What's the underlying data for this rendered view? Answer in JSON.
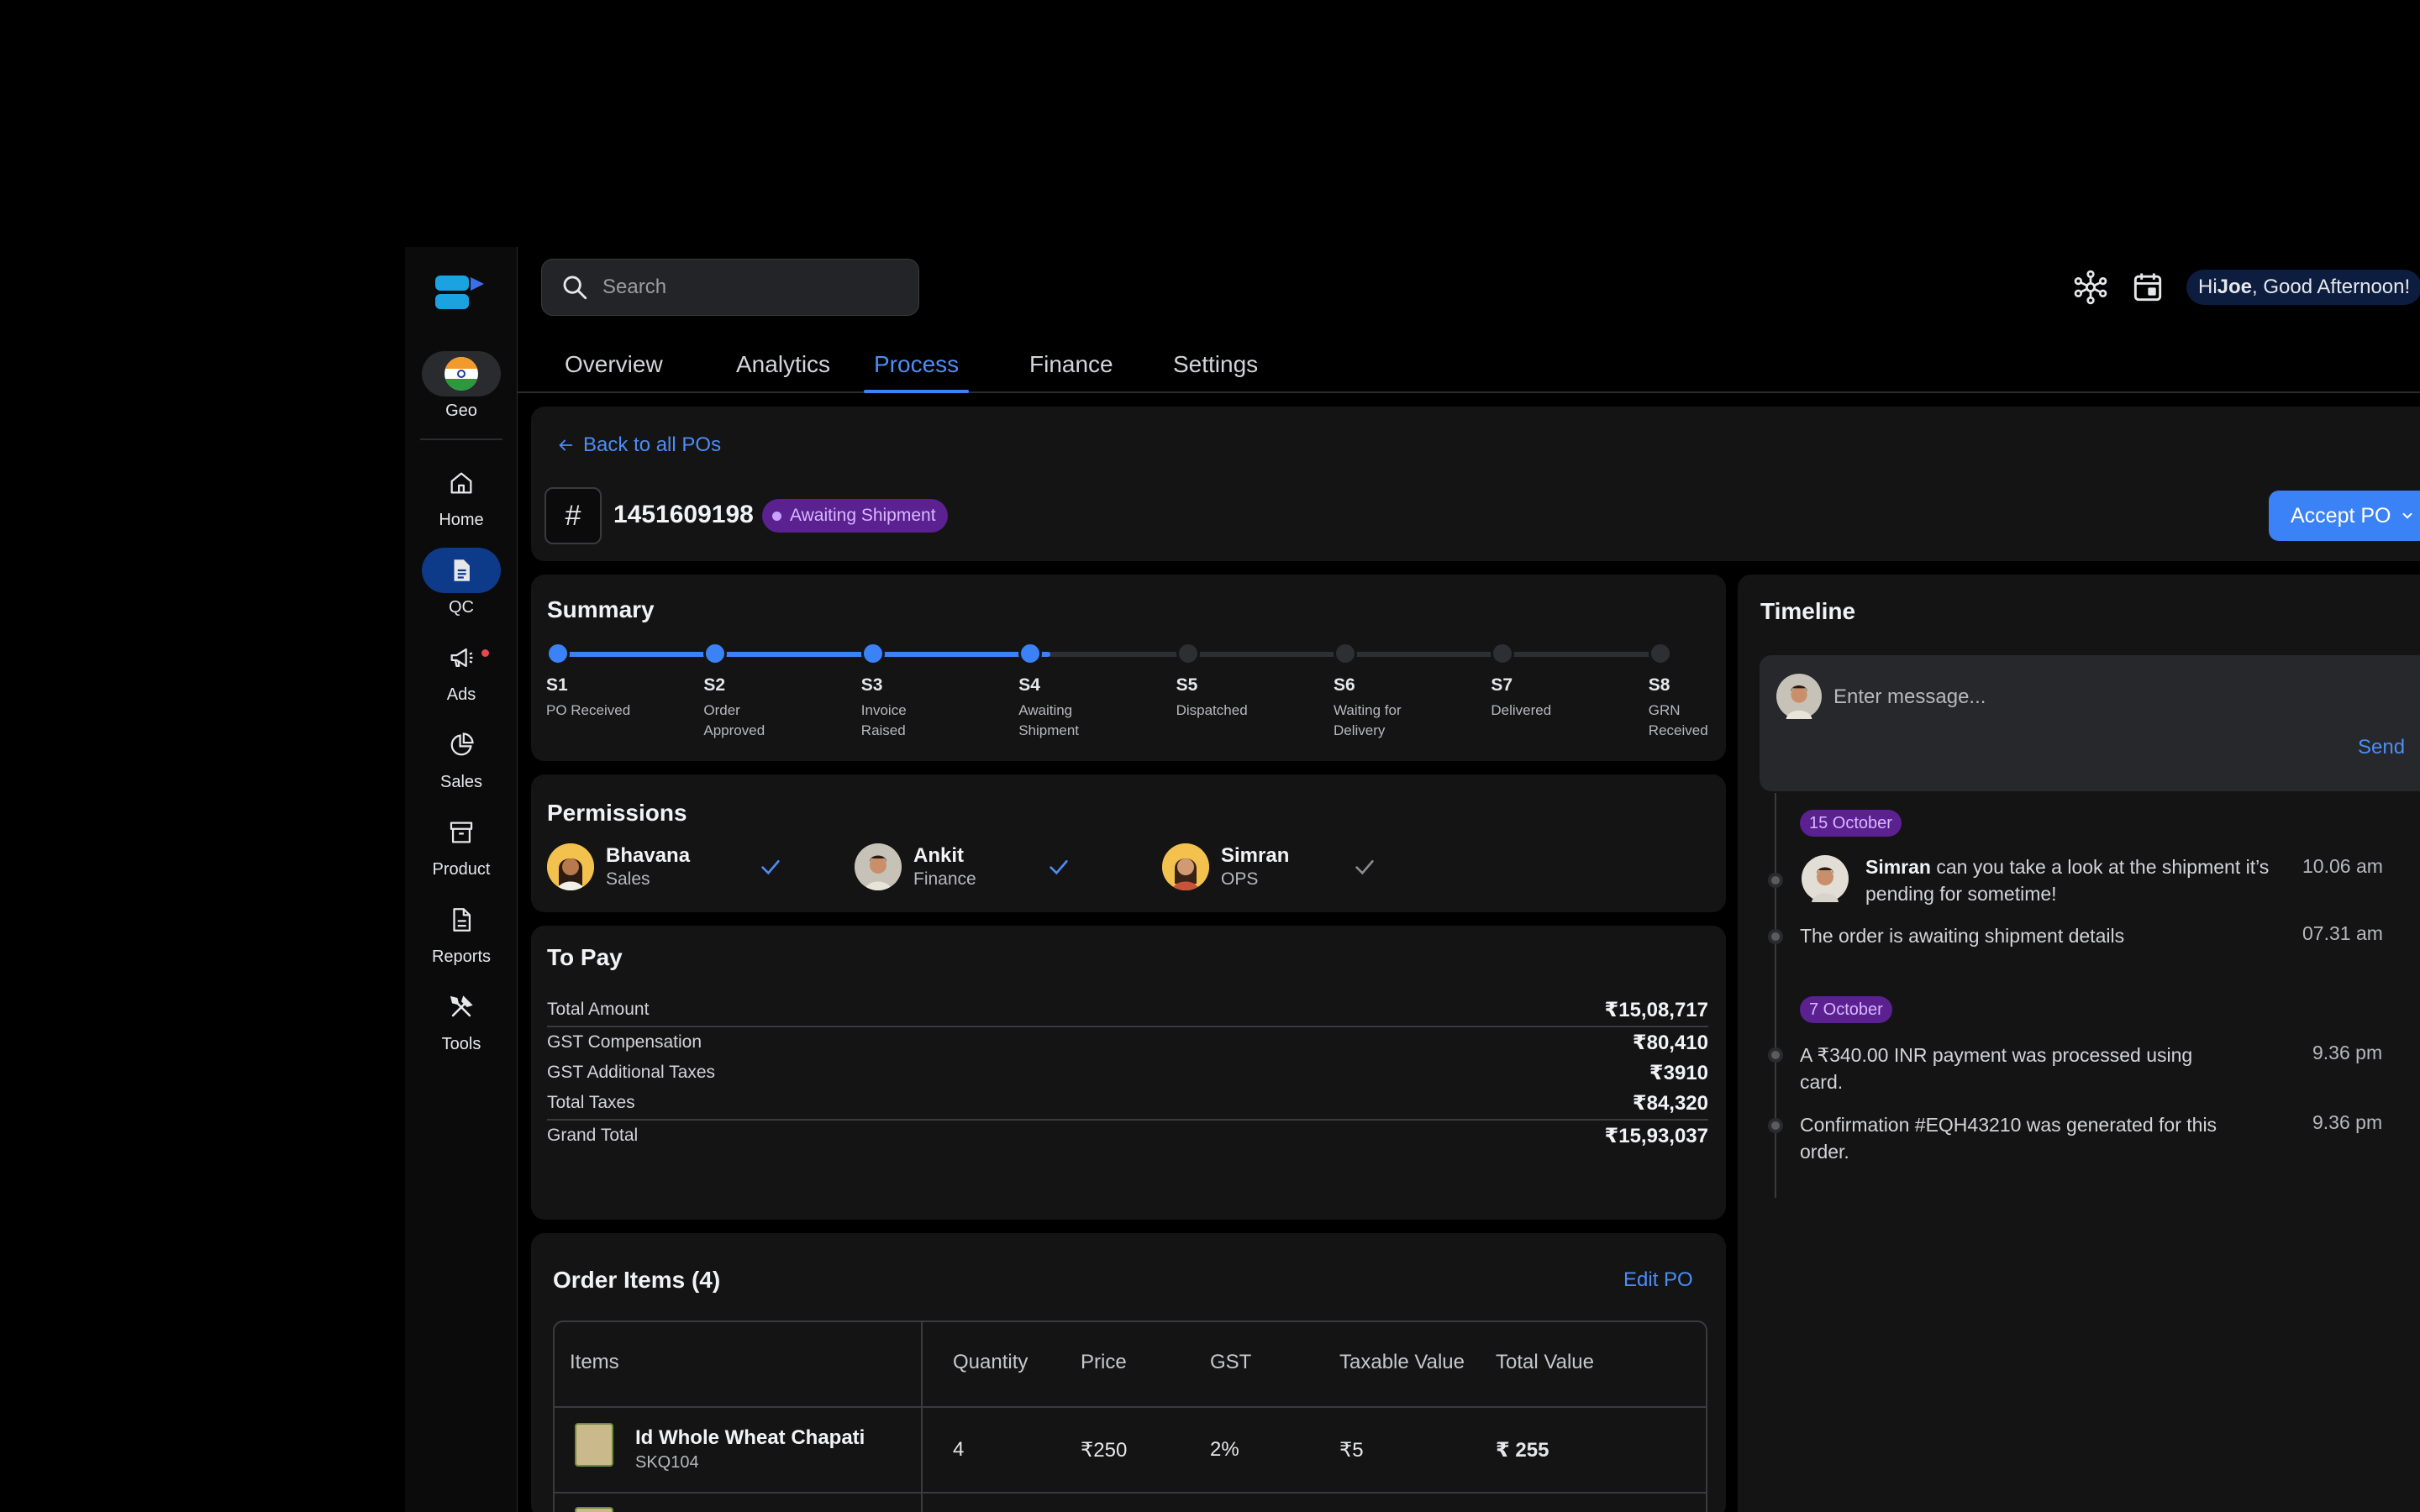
{
  "sidebar": {
    "geo_label": "Geo",
    "items": [
      {
        "label": "Home",
        "icon": "home-icon"
      },
      {
        "label": "QC",
        "icon": "document-icon",
        "active": true
      },
      {
        "label": "Ads",
        "icon": "megaphone-icon",
        "notification": true
      },
      {
        "label": "Sales",
        "icon": "pie-chart-icon"
      },
      {
        "label": "Product",
        "icon": "archive-icon"
      },
      {
        "label": "Reports",
        "icon": "report-icon"
      },
      {
        "label": "Tools",
        "icon": "tools-icon"
      }
    ]
  },
  "header": {
    "search_placeholder": "Search",
    "greeting_prefix": "Hi ",
    "greeting_name": "Joe",
    "greeting_suffix": ", Good Afternoon!"
  },
  "tabs": [
    {
      "label": "Overview"
    },
    {
      "label": "Analytics"
    },
    {
      "label": "Process",
      "active": true
    },
    {
      "label": "Finance"
    },
    {
      "label": "Settings"
    }
  ],
  "po": {
    "back_label": "Back to all POs",
    "hash": "#",
    "number": "1451609198",
    "status": "Awaiting Shipment",
    "accept_label": "Accept PO"
  },
  "summary": {
    "title": "Summary",
    "completed_steps": 4,
    "steps": [
      {
        "code": "S1",
        "desc": "PO Received"
      },
      {
        "code": "S2",
        "desc": "Order Approved"
      },
      {
        "code": "S3",
        "desc": "Invoice Raised"
      },
      {
        "code": "S4",
        "desc": "Awaiting Shipment"
      },
      {
        "code": "S5",
        "desc": "Dispatched"
      },
      {
        "code": "S6",
        "desc": "Waiting for Delivery"
      },
      {
        "code": "S7",
        "desc": "Delivered"
      },
      {
        "code": "S8",
        "desc": "GRN Received"
      }
    ]
  },
  "permissions": {
    "title": "Permissions",
    "people": [
      {
        "name": "Bhavana",
        "role": "Sales",
        "approved": true
      },
      {
        "name": "Ankit",
        "role": "Finance",
        "approved": true
      },
      {
        "name": "Simran",
        "role": "OPS",
        "approved": false
      }
    ]
  },
  "to_pay": {
    "title": "To Pay",
    "rows": [
      {
        "label": "Total Amount",
        "value": "₹15,08,717"
      },
      {
        "label": "GST Compensation",
        "value": "₹80,410"
      },
      {
        "label": "GST Additional Taxes",
        "value": "₹3910"
      },
      {
        "label": "Total Taxes",
        "value": "₹84,320"
      },
      {
        "label": "Grand Total",
        "value": "₹15,93,037"
      }
    ]
  },
  "order_items": {
    "title": "Order Items (4)",
    "edit_label": "Edit PO",
    "columns": [
      "Items",
      "Quantity",
      "Price",
      "GST",
      "Taxable Value",
      "Total Value"
    ],
    "rows": [
      {
        "name": "Id Whole Wheat Chapati",
        "sku": "SKQ104",
        "quantity": "4",
        "price": "₹250",
        "gst": "2%",
        "taxable": "₹5",
        "total": "₹ 255"
      }
    ]
  },
  "timeline": {
    "title": "Timeline",
    "message_placeholder": "Enter message...",
    "send_label": "Send",
    "groups": [
      {
        "date": "15 October",
        "events": [
          {
            "bold": "Simran",
            "text": " can you take a look at the shipment it’s pending for sometime!",
            "time": "10.06 am"
          },
          {
            "bold": "",
            "text": "The order is awaiting shipment details",
            "time": "07.31 am"
          }
        ]
      },
      {
        "date": "7 October",
        "events": [
          {
            "bold": "",
            "text": "A ₹340.00 INR payment was processed using card.",
            "time": "9.36 pm"
          },
          {
            "bold": "",
            "text": "Confirmation #EQH43210 was generated for this order.",
            "time": "9.36 pm"
          }
        ]
      }
    ]
  },
  "colors": {
    "accent": "#3b82f6",
    "badge": "#5b2191",
    "panel": "#141415",
    "background": "#000000"
  }
}
